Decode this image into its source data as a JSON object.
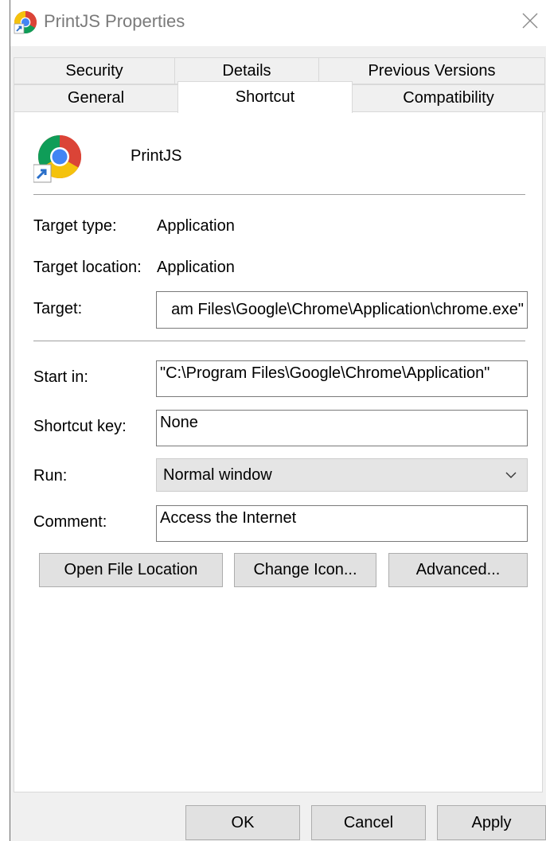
{
  "window": {
    "title": "PrintJS Properties",
    "close_icon": "close-icon",
    "app_icon": "chrome-shortcut-icon"
  },
  "tabs": {
    "row1": [
      {
        "label": "Security"
      },
      {
        "label": "Details"
      },
      {
        "label": "Previous Versions"
      }
    ],
    "row2": [
      {
        "label": "General"
      },
      {
        "label": "Shortcut",
        "active": true
      },
      {
        "label": "Compatibility"
      }
    ]
  },
  "shortcut": {
    "name": "PrintJS",
    "target_type_label": "Target type:",
    "target_type_value": "Application",
    "target_location_label": "Target location:",
    "target_location_value": "Application",
    "target_label": "Target:",
    "target_value": "am Files\\Google\\Chrome\\Application\\chrome.exe\"",
    "start_in_label": "Start in:",
    "start_in_value": "\"C:\\Program Files\\Google\\Chrome\\Application\"",
    "shortcut_key_label": "Shortcut key:",
    "shortcut_key_value": "None",
    "run_label": "Run:",
    "run_value": "Normal window",
    "comment_label": "Comment:",
    "comment_value": "Access the Internet",
    "open_file_location_label": "Open File Location",
    "change_icon_label": "Change Icon...",
    "advanced_label": "Advanced..."
  },
  "footer": {
    "ok_label": "OK",
    "cancel_label": "Cancel",
    "apply_label": "Apply"
  },
  "colors": {
    "dialog_bg": "#f0f0f0",
    "page_bg": "#ffffff",
    "button_bg": "#e1e1e1",
    "chrome_red": "#db4437",
    "chrome_yellow": "#f4c20d",
    "chrome_green": "#0f9d58",
    "chrome_blue": "#4285f4"
  }
}
